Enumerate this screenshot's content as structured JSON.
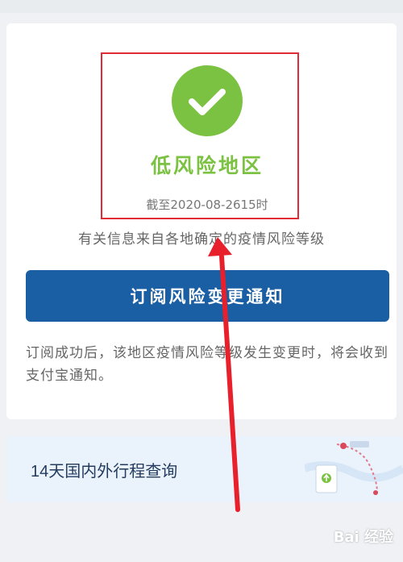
{
  "risk": {
    "level": "低风险地区",
    "as_of": "截至2020-08-2615时",
    "source_note": "有关信息来自各地确定的疫情风险等级"
  },
  "subscribe": {
    "button_label": "订阅风险变更通知",
    "note": "订阅成功后，该地区疫情风险等级发生变更时，将会收到支付宝通知。"
  },
  "itinerary": {
    "title": "14天国内外行程查询"
  },
  "watermark": {
    "text": "Bai 经验"
  },
  "colors": {
    "success": "#7cc242",
    "primary_button": "#1a5ea4",
    "annotation_red": "#e02c36"
  },
  "icons": {
    "status": "checkmark-icon",
    "itinerary": "map-route-icon"
  }
}
